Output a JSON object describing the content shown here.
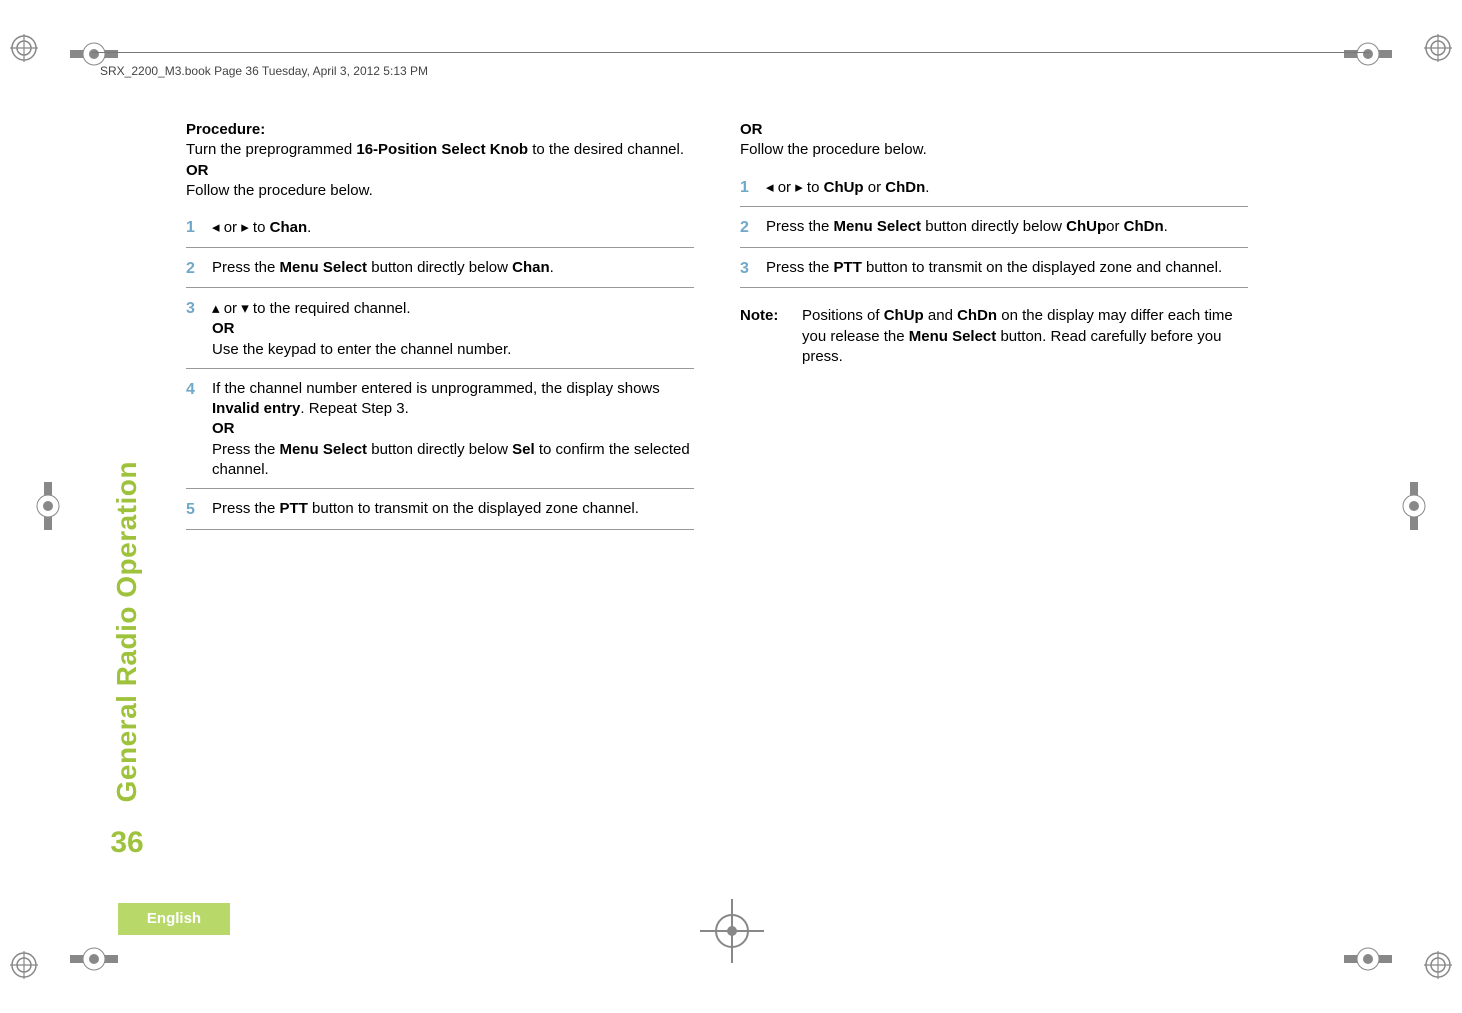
{
  "header": {
    "running_head": "SRX_2200_M3.book  Page 36  Tuesday, April 3, 2012  5:13 PM"
  },
  "side": {
    "section_label": "General Radio Operation",
    "page_number": "36",
    "language": "English"
  },
  "col1": {
    "procedure_label": "Procedure:",
    "procedure_line1a": "Turn the preprogrammed ",
    "procedure_line1b": "16-Position Select Knob",
    "procedure_line1c": " to the desired channel.",
    "or": "OR",
    "follow": "Follow the procedure below.",
    "step1_a": " or ",
    "step1_b": " to ",
    "chan": "Chan",
    "step1_c": ".",
    "step2_a": "Press the ",
    "step2_b": "Menu Select",
    "step2_c": " button directly below ",
    "step3_a": " or ",
    "step3_b": " to the required channel.",
    "step3_or": "OR",
    "step3_c": "Use the keypad to enter the channel number.",
    "step4_a": "If the channel number entered is unprogrammed, the display shows ",
    "step4_b": "Invalid entry",
    "step4_c": ". Repeat Step 3.",
    "step4_or": "OR",
    "step4_d": "Press the ",
    "step4_e": "Menu Select",
    "step4_f": " button directly below ",
    "sel": "Sel",
    "step4_g": " to confirm the selected channel.",
    "step5_a": "Press the ",
    "step5_b": "PTT",
    "step5_c": " button to transmit on the displayed zone channel."
  },
  "col2": {
    "or": "OR",
    "follow": "Follow the procedure below.",
    "step1_a": " or ",
    "step1_b": " to ",
    "chup": "ChUp",
    "step1_c": " or ",
    "chdn": "ChDn",
    "step1_d": ".",
    "step2_a": "Press the ",
    "step2_b": "Menu Select",
    "step2_c": " button directly below ",
    "step2_d": "or ",
    "step3_a": "Press the ",
    "step3_b": "PTT",
    "step3_c": " button to transmit on the displayed zone and channel.",
    "note_label": "Note:",
    "note_a": "Positions of ",
    "note_b": " and ",
    "note_c": " on the display may differ each time you release the ",
    "note_d": "Menu Select",
    "note_e": " button. Read carefully before you press."
  },
  "glyphs": {
    "left": "◂",
    "right": "▸",
    "up": "▴",
    "down": "▾"
  },
  "step_numbers": [
    "1",
    "2",
    "3",
    "4",
    "5"
  ]
}
